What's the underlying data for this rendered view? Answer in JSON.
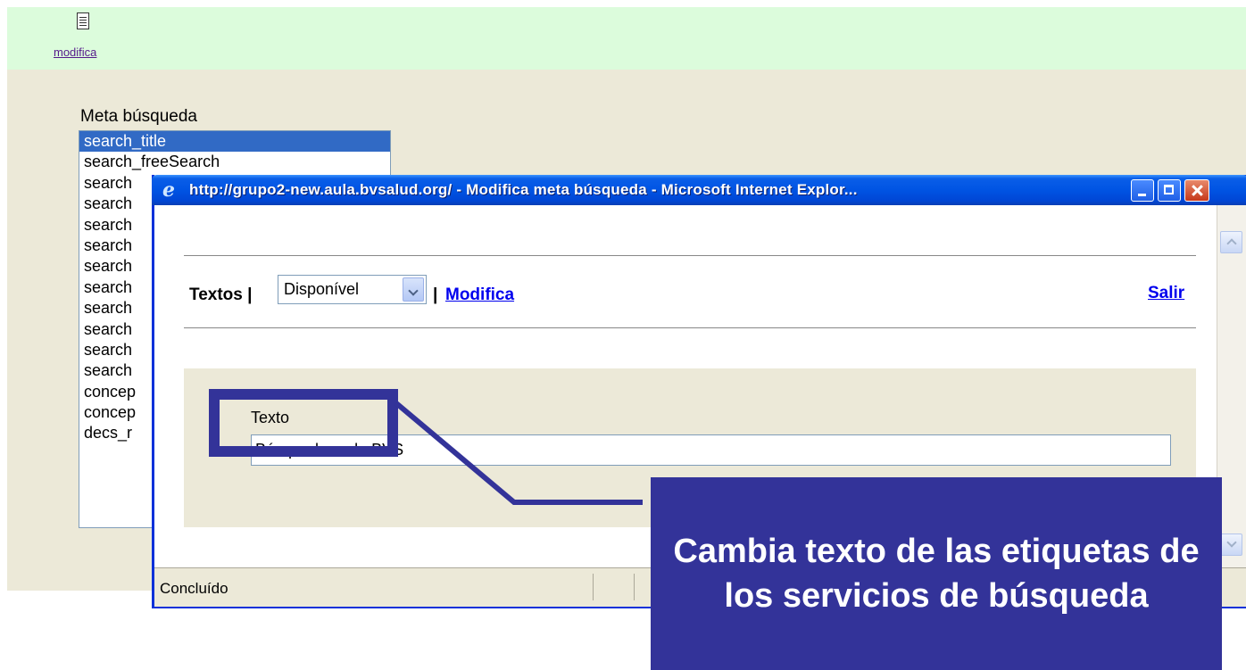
{
  "page": {
    "modifica_link": "modifica",
    "meta_label": "Meta búsqueda",
    "list_items": [
      "search_title",
      "search_freeSearch",
      "search",
      "search",
      "search",
      "search",
      "search",
      "search",
      "search",
      "search",
      "search",
      "search",
      "concep",
      "concep",
      "decs_r"
    ]
  },
  "ie_window": {
    "title": "http://grupo2-new.aula.bvsalud.org/ - Modifica meta búsqueda - Microsoft Internet Explor...",
    "nav": {
      "textos": "Textos |",
      "select_value": "Disponível",
      "separator": "|",
      "modifica": "Modifica",
      "salir": "Salir"
    },
    "form": {
      "label": "Texto",
      "value": "Búsqueda en la BVS"
    },
    "status": "Concluído"
  },
  "callout": {
    "text": "Cambia texto de las etiquetas de los servicios de búsqueda"
  },
  "colors": {
    "annotation": "#333399",
    "titlebar": "#0054e3",
    "selection": "#316ac5"
  }
}
